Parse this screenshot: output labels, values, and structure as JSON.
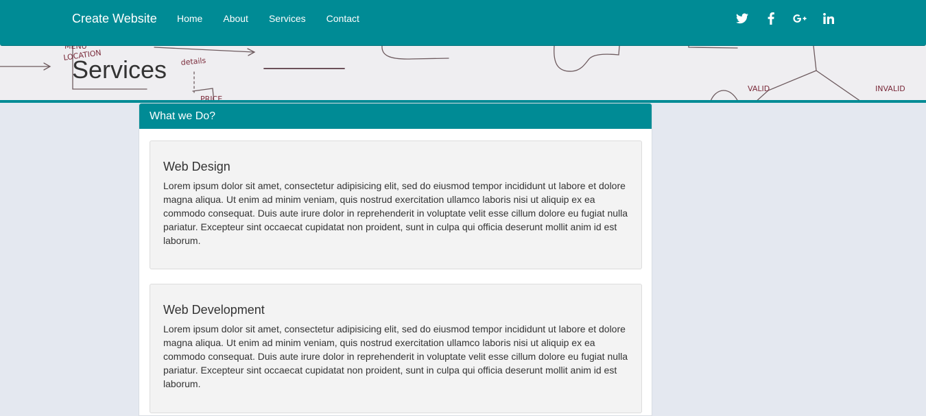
{
  "navbar": {
    "brand": "Create Website",
    "links": [
      "Home",
      "About",
      "Services",
      "Contact"
    ],
    "social": [
      "twitter-icon",
      "facebook-icon",
      "google-plus-icon",
      "linkedin-icon"
    ],
    "color": "#008b95"
  },
  "hero": {
    "title": "Services",
    "sketch_labels": [
      "LOCATION",
      "details",
      "PRICE",
      "VALID",
      "INVALID"
    ]
  },
  "panel": {
    "heading": "What we Do?",
    "cards": [
      {
        "title": "Web Design",
        "body": "Lorem ipsum dolor sit amet, consectetur adipisicing elit, sed do eiusmod tempor incididunt ut labore et dolore magna aliqua. Ut enim ad minim veniam, quis nostrud exercitation ullamco laboris nisi ut aliquip ex ea commodo consequat. Duis aute irure dolor in reprehenderit in voluptate velit esse cillum dolore eu fugiat nulla pariatur. Excepteur sint occaecat cupidatat non proident, sunt in culpa qui officia deserunt mollit anim id est laborum."
      },
      {
        "title": "Web Development",
        "body": "Lorem ipsum dolor sit amet, consectetur adipisicing elit, sed do eiusmod tempor incididunt ut labore et dolore magna aliqua. Ut enim ad minim veniam, quis nostrud exercitation ullamco laboris nisi ut aliquip ex ea commodo consequat. Duis aute irure dolor in reprehenderit in voluptate velit esse cillum dolore eu fugiat nulla pariatur. Excepteur sint occaecat cupidatat non proident, sunt in culpa qui officia deserunt mollit anim id est laborum."
      }
    ]
  }
}
